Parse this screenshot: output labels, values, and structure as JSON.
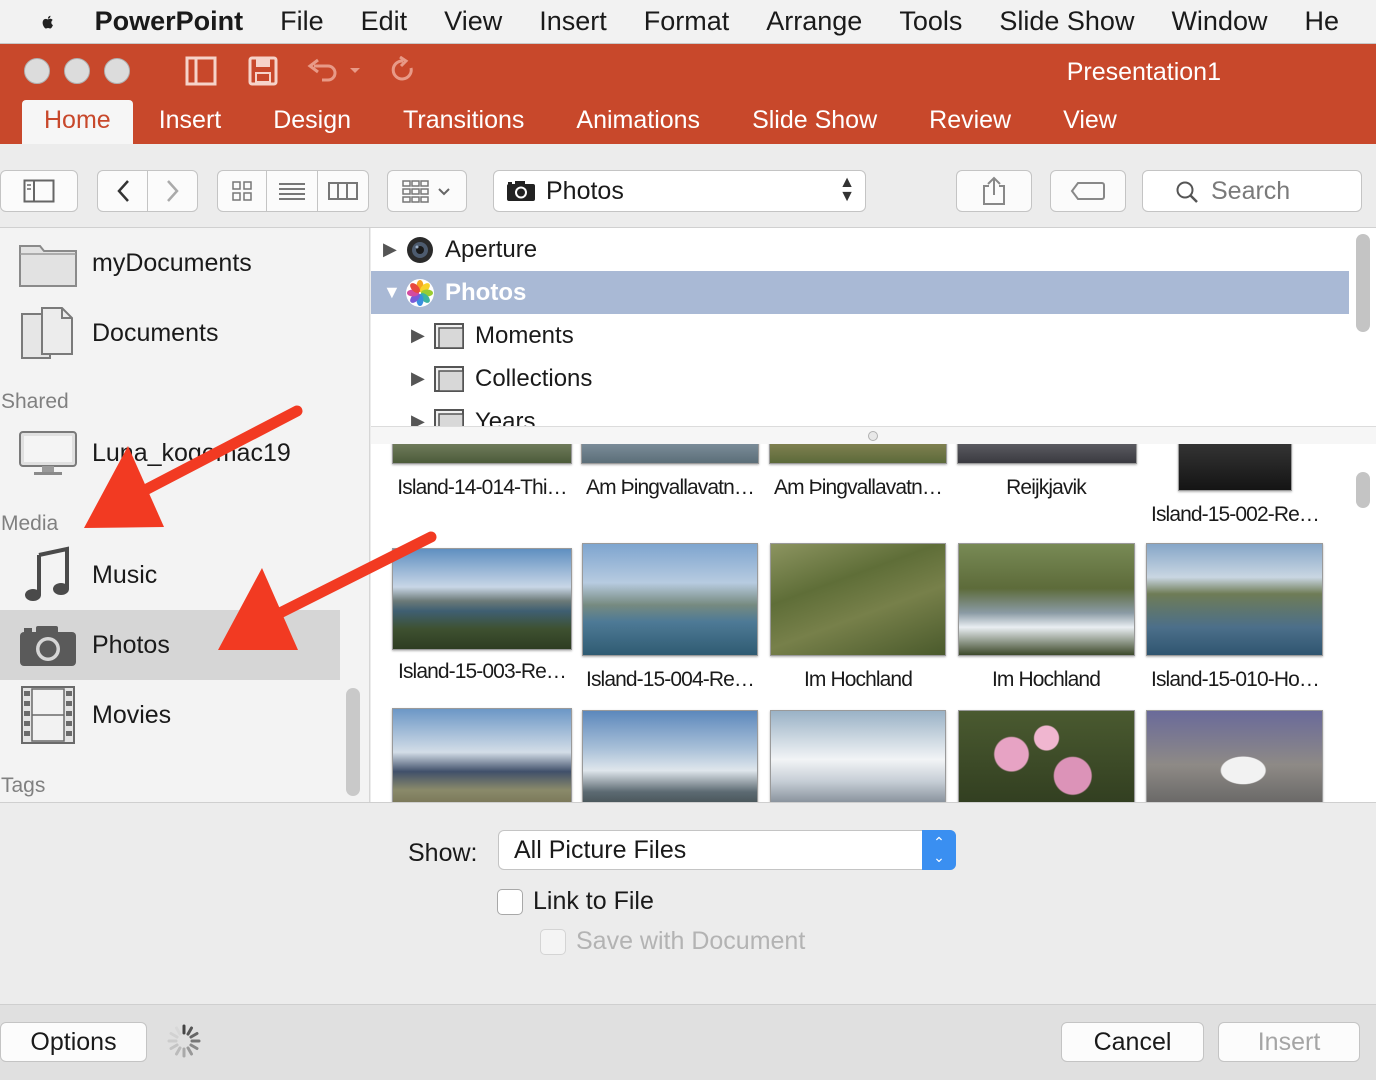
{
  "menubar": {
    "app": "PowerPoint",
    "items": [
      "File",
      "Edit",
      "View",
      "Insert",
      "Format",
      "Arrange",
      "Tools",
      "Slide Show",
      "Window",
      "He"
    ]
  },
  "ribbon": {
    "title": "Presentation1",
    "tabs": [
      {
        "label": "Home",
        "active": true
      },
      {
        "label": "Insert"
      },
      {
        "label": "Design"
      },
      {
        "label": "Transitions"
      },
      {
        "label": "Animations"
      },
      {
        "label": "Slide Show"
      },
      {
        "label": "Review"
      },
      {
        "label": "View"
      }
    ]
  },
  "toolbar": {
    "source_label": "Photos",
    "search_placeholder": "Search"
  },
  "sidebar": {
    "favorites": [
      {
        "label": "myDocuments",
        "icon": "folder-icon"
      },
      {
        "label": "Documents",
        "icon": "documents-icon"
      }
    ],
    "shared_header": "Shared",
    "shared": [
      {
        "label": "Luna_kogemac19",
        "icon": "computer-icon"
      }
    ],
    "media_header": "Media",
    "media": [
      {
        "label": "Music",
        "icon": "music-note-icon"
      },
      {
        "label": "Photos",
        "icon": "camera-icon",
        "selected": true
      },
      {
        "label": "Movies",
        "icon": "film-icon"
      }
    ],
    "tags_header": "Tags"
  },
  "tree": {
    "rows": [
      {
        "label": "Aperture",
        "expanded": false
      },
      {
        "label": "Photos",
        "expanded": true,
        "selected": true
      },
      {
        "label": "Moments",
        "expanded": false
      },
      {
        "label": "Collections",
        "expanded": false
      },
      {
        "label": "Years",
        "expanded": false
      }
    ]
  },
  "grid": {
    "row1_captions": [
      "Island-14-014-Thi…",
      "Am Þingvallavatn…",
      "Am Þingvallavatn…",
      "Reijkjavik",
      "Island-15-002-Re…"
    ],
    "row2_captions": [
      "Island-15-003-Re…",
      "Island-15-004-Re…",
      "Im Hochland",
      "Im Hochland",
      "Island-15-010-Ho…"
    ]
  },
  "options": {
    "show_label": "Show:",
    "show_value": "All Picture Files",
    "link_to_file": "Link to File",
    "save_with_document": "Save with Document"
  },
  "footer": {
    "options": "Options",
    "cancel": "Cancel",
    "insert": "Insert"
  },
  "colors": {
    "ribbon": "#c8482b",
    "selection": "#a9b9d5",
    "accent": "#3a8ff1",
    "annotation_arrow": "#f23a22"
  }
}
